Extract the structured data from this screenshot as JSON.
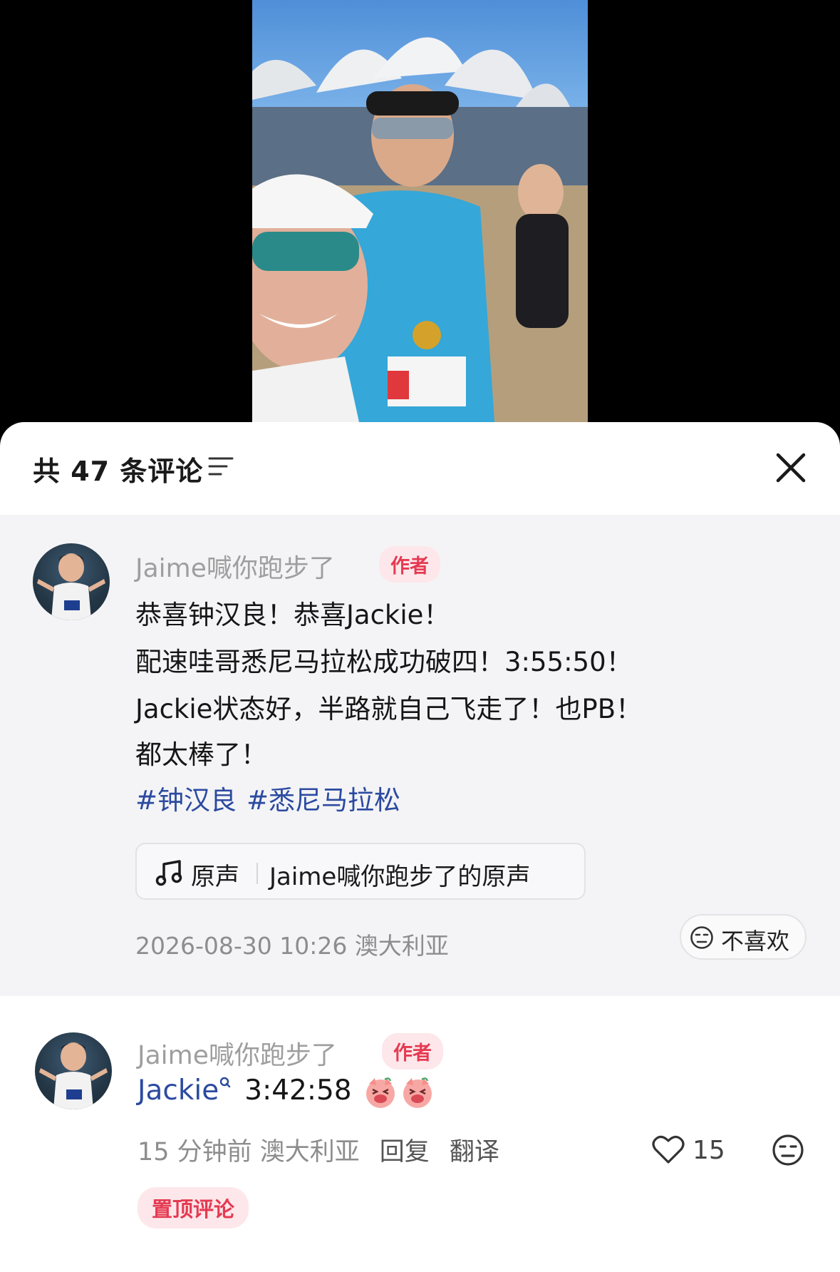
{
  "header": {
    "comment_count": "共 47 条评论"
  },
  "pinned_comment": {
    "author": "Jaime喊你跑步了",
    "badge": "作者",
    "lines": [
      "恭喜钟汉良！恭喜Jackie！",
      "配速哇哥悉尼马拉松成功破四！3:55:50！",
      "Jackie状态好，半路就自己飞走了！也PB！",
      "都太棒了！"
    ],
    "hashtags": [
      "#钟汉良",
      "#悉尼马拉松"
    ],
    "music": {
      "label": "原声",
      "title": "Jaime喊你跑步了的原声"
    },
    "timestamp": "2026-08-30 10:26 澳大利亚",
    "dislike_label": "不喜欢"
  },
  "reply_comment": {
    "author": "Jaime喊你跑步了",
    "badge": "作者",
    "mention": "Jackie",
    "time_text": "3:42:58",
    "meta": "15 分钟前 澳大利亚",
    "reply_label": "回复",
    "translate_label": "翻译",
    "like_count": "15",
    "pinned_label": "置顶评论"
  },
  "colors": {
    "accent_red": "#e53a52",
    "hashtag_blue": "#2b4aa0",
    "muted_text": "#8d8d8d"
  },
  "icons": [
    "sort-icon",
    "close-icon",
    "music-note-icon",
    "dislike-face-icon",
    "heart-icon",
    "pig-emoji-icon",
    "mention-superscript-icon"
  ]
}
